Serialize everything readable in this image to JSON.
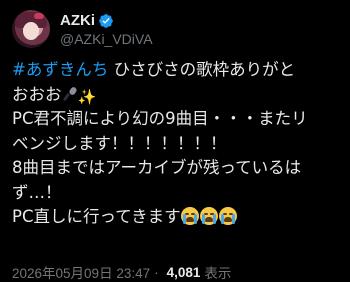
{
  "author": {
    "display_name": "AZKi",
    "handle": "@AZKi_VDiVA",
    "avatar_icon": "avatar-portrait",
    "verified_icon": "verified-badge-icon",
    "verified_color": "#1d9bf0"
  },
  "tweet": {
    "hashtag": "#あずきんち",
    "lines": [
      " ひさびさの歌枠ありがと",
      "おおお",
      "PC君不調により幻の9曲目・・・またリ",
      "ベンジします！！！！！！！",
      "8曲目まではアーカイブが残っているは",
      "ず…！",
      "PC直しに行ってきます"
    ],
    "emojis": {
      "mic": "microphone-emoji",
      "sparkles": "sparkles-emoji",
      "crying": "loudly-crying-face-emoji"
    }
  },
  "meta": {
    "timestamp": "2026年05月09日 23:47",
    "separator": "·",
    "views_count": "4,081",
    "views_label": "表示"
  },
  "colors": {
    "background": "#000000",
    "text": "#e7e9ea",
    "secondary": "#71767b",
    "accent": "#1d9bf0"
  }
}
